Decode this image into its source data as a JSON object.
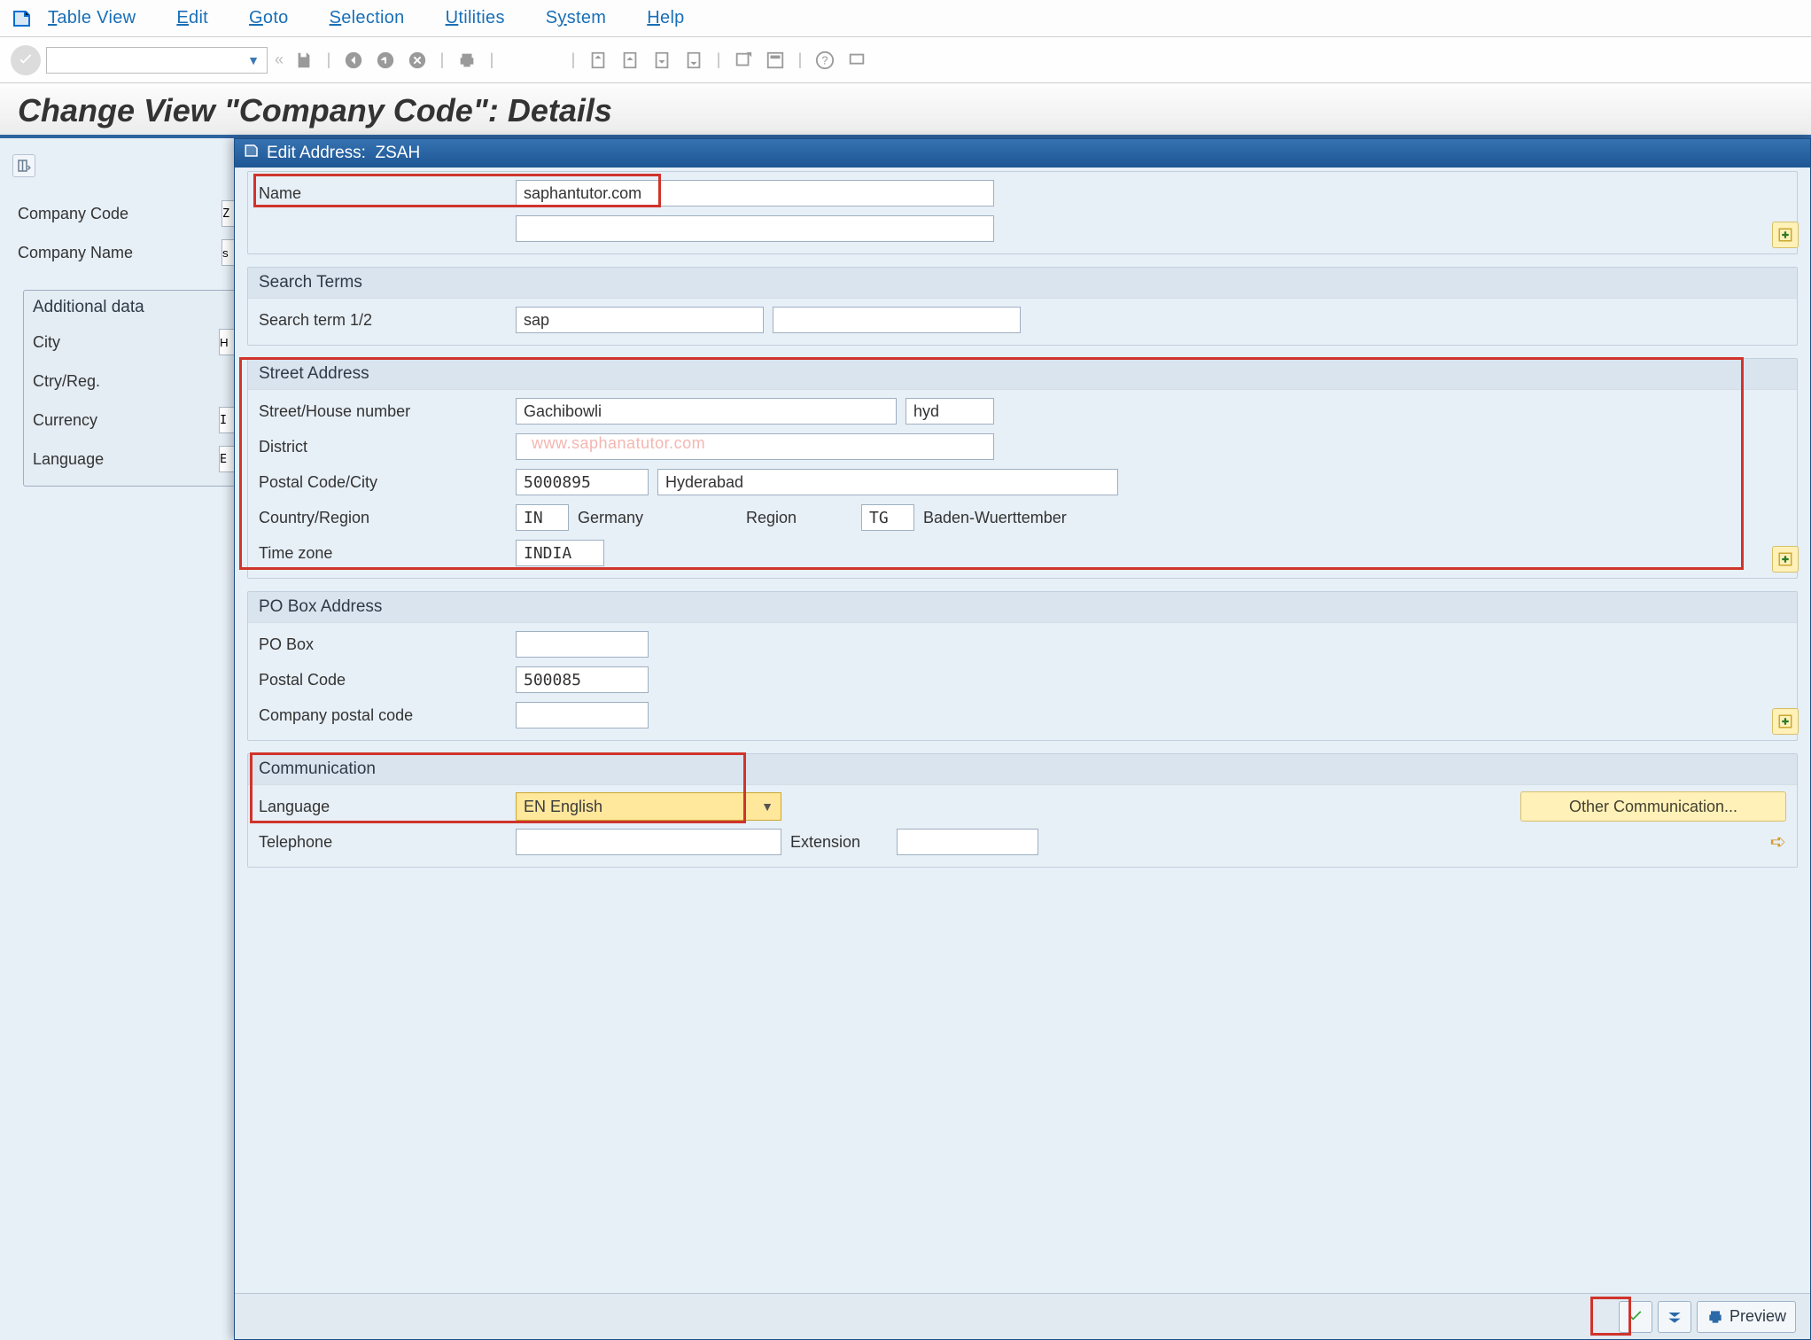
{
  "menu": {
    "items": [
      "Table View",
      "Edit",
      "Goto",
      "Selection",
      "Utilities",
      "System",
      "Help"
    ]
  },
  "page_title": "Change View \"Company Code\": Details",
  "bg": {
    "company_code_label": "Company Code",
    "company_code_value": "Z",
    "company_name_label": "Company Name",
    "company_name_value": "s",
    "additional_data_label": "Additional data",
    "city_label": "City",
    "city_value": "H",
    "ctryreg_label": "Ctry/Reg.",
    "currency_label": "Currency",
    "currency_value": "I",
    "language_label": "Language",
    "language_value": "E"
  },
  "dialog": {
    "title_prefix": "Edit Address:",
    "title_code": "ZSAH",
    "name_section": {
      "name_label": "Name",
      "name_value": "saphantutor.com",
      "name2_value": ""
    },
    "search_section": {
      "head": "Search Terms",
      "label_12": "Search term 1/2",
      "term1": "sap",
      "term2": ""
    },
    "street_section": {
      "head": "Street Address",
      "street_label": "Street/House number",
      "street_value": "Gachibowli",
      "house_value": "hyd",
      "district_label": "District",
      "district_value": "",
      "postal_label": "Postal Code/City",
      "postal_value": "5000895",
      "city_value": "Hyderabad",
      "country_label": "Country/Region",
      "country_value": "IN",
      "country_text": "Germany",
      "region_label": "Region",
      "region_value": "TG",
      "region_text": "Baden-Wuerttember",
      "timezone_label": "Time zone",
      "timezone_value": "INDIA"
    },
    "pobox_section": {
      "head": "PO Box Address",
      "pobox_label": "PO Box",
      "pobox_value": "",
      "postal_label": "Postal Code",
      "postal_value": "500085",
      "comp_postal_label": "Company postal code",
      "comp_postal_value": ""
    },
    "comm_section": {
      "head": "Communication",
      "language_label": "Language",
      "language_value": "EN English",
      "other_comm_label": "Other Communication...",
      "telephone_label": "Telephone",
      "telephone_value": "",
      "extension_label": "Extension",
      "extension_value": ""
    },
    "footer": {
      "preview_label": "Preview"
    }
  },
  "watermark": "www.saphanatutor.com"
}
